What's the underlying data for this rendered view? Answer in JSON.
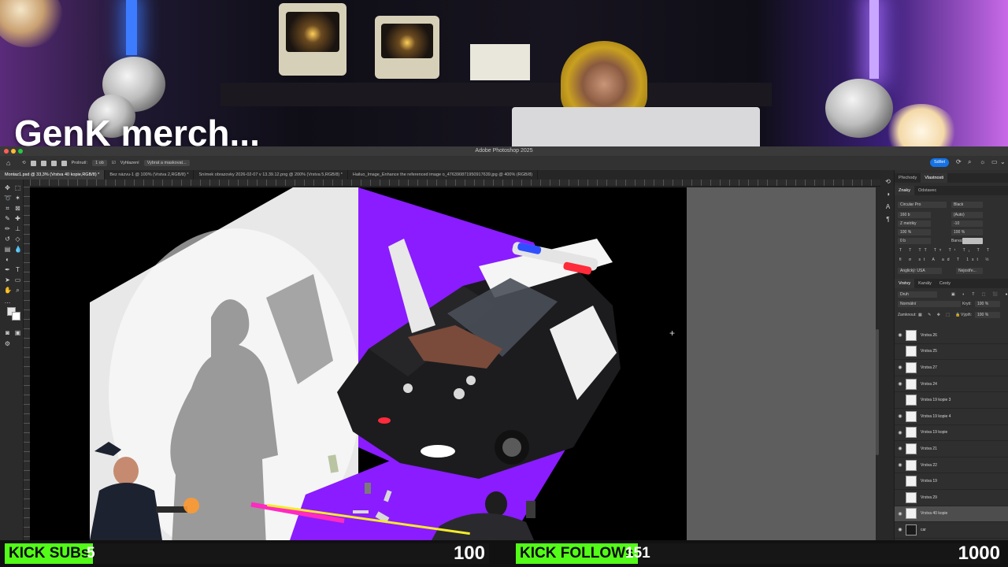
{
  "stream": {
    "caption": "GenK merch..."
  },
  "photoshop": {
    "window_title": "Adobe Photoshop 2025",
    "options_bar": {
      "feather_label": "Prolnutí:",
      "feather_value": "1 ob",
      "antialias_label": "Vyhlazení",
      "select_mask_button": "Vybrat a maskovat..."
    },
    "share_button": "Sdílet",
    "doc_tabs": [
      {
        "label": "Montaz1.psd @ 33,3% (Vrstva 40 kopie,RGB/8) *",
        "active": true
      },
      {
        "label": "Bez názvu-1 @ 100% (Vrstva 2,RGB/8) *",
        "active": false
      },
      {
        "label": "Snímek obrazovky 2026-02-07 v 13.39.12.png @ 200% (Vrstva 5,RGB/8) *",
        "active": false
      },
      {
        "label": "Hailuo_Image_Enhance the referenced image o_476390871950917639.jpg @ 400% (RGB/8)",
        "active": false
      }
    ],
    "properties_panel": {
      "tabs": [
        "Přechody",
        "Vlastnosti"
      ],
      "subtabs": [
        "Znaky",
        "Odstavec"
      ],
      "font_family": "Circular Pro",
      "font_style": "Black",
      "font_size": "160 b",
      "leading": "(Auto)",
      "kerning": "Z metriky",
      "tracking": "-10",
      "vscale": "100 %",
      "hscale": "100 %",
      "baseline": "0 b",
      "color_label": "Barva:",
      "language": "Anglický: USA",
      "antialias": "Nejostře..."
    },
    "layers_panel": {
      "tabs": [
        "Vrstvy",
        "Kanály",
        "Cesty"
      ],
      "filter": "Druh",
      "blend_mode": "Normální",
      "opacity_label": "Krytí:",
      "opacity_value": "100 %",
      "lock_label": "Zamknout:",
      "fill_label": "Výplň:",
      "fill_value": "100 %",
      "layers": [
        {
          "name": "Vrstva 26",
          "visible": true,
          "selected": false
        },
        {
          "name": "Vrstva 25",
          "visible": false,
          "selected": false
        },
        {
          "name": "Vrstva 27",
          "visible": true,
          "selected": false
        },
        {
          "name": "Vrstva 24",
          "visible": true,
          "selected": false
        },
        {
          "name": "Vrstva 19 kopie 3",
          "visible": false,
          "selected": false
        },
        {
          "name": "Vrstva 19 kopie 4",
          "visible": true,
          "selected": false
        },
        {
          "name": "Vrstva 19 kopie",
          "visible": true,
          "selected": false
        },
        {
          "name": "Vrstva 21",
          "visible": true,
          "selected": false
        },
        {
          "name": "Vrstva 22",
          "visible": true,
          "selected": false
        },
        {
          "name": "Vrstva 19",
          "visible": false,
          "selected": false
        },
        {
          "name": "Vrstva 29",
          "visible": false,
          "selected": false
        },
        {
          "name": "Vrstva 40 kopie",
          "visible": true,
          "selected": true
        },
        {
          "name": "car",
          "visible": true,
          "selected": false
        }
      ]
    }
  },
  "overlay": {
    "subs_label": "KICK SUBs",
    "subs_count": "5",
    "subs_goal": "100",
    "subs_progress": 0.05,
    "follows_label": "KICK FOLLOWs",
    "follows_count": "151",
    "follows_goal": "1000",
    "follows_progress": 0.151,
    "accent_color": "#53fc18"
  },
  "colors": {
    "canvas_purple": "#8a1cff",
    "panel_bg": "#2f2f2f",
    "share_blue": "#1473e6"
  }
}
